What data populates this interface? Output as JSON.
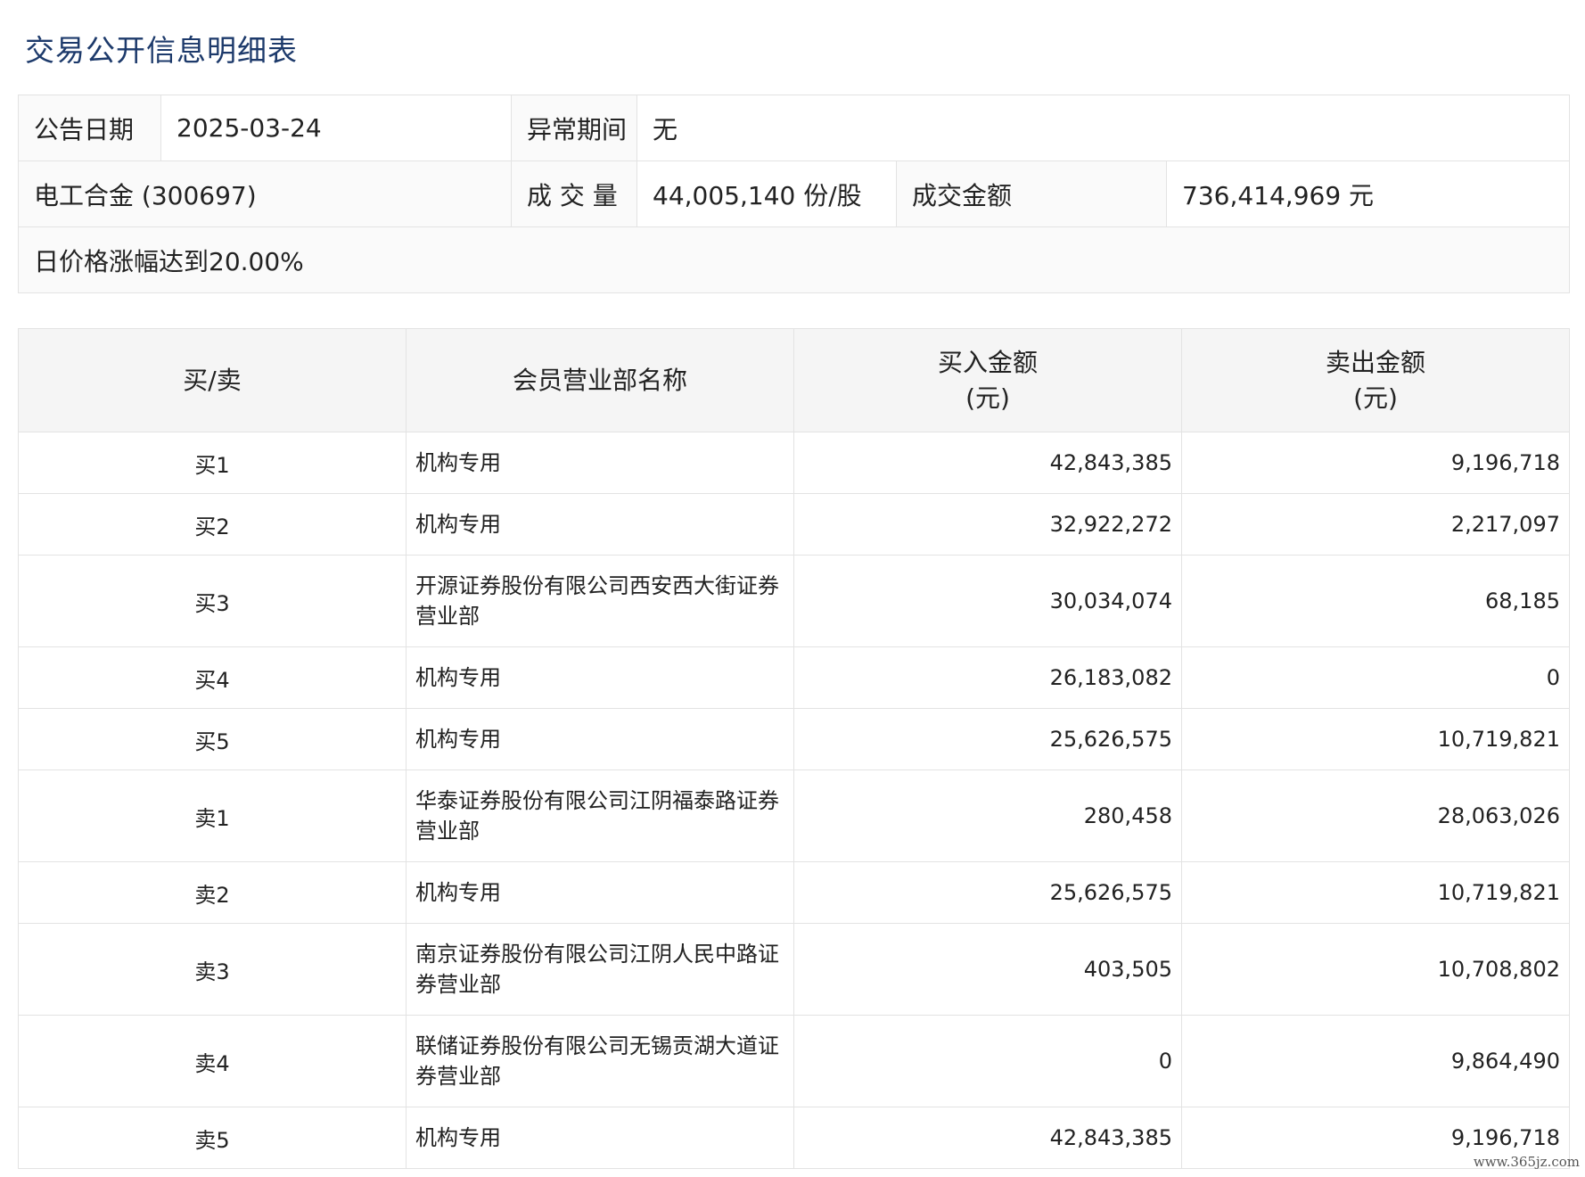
{
  "page_title": "交易公开信息明细表",
  "info": {
    "announce_date_label": "公告日期",
    "announce_date_value": "2025-03-24",
    "abnormal_period_label": "异常期间",
    "abnormal_period_value": "无",
    "stock_name": "电工合金 (300697)",
    "volume_label": "成 交 量",
    "volume_value": "44,005,140 份/股",
    "turnover_label": "成交金额",
    "turnover_value": "736,414,969 元",
    "reason": "日价格涨幅达到20.00%"
  },
  "table": {
    "headers": {
      "side": "买/卖",
      "member": "会员营业部名称",
      "buy_line1": "买入金额",
      "buy_line2": "(元)",
      "sell_line1": "卖出金额",
      "sell_line2": "(元)"
    },
    "rows": [
      {
        "side": "买1",
        "name": "机构专用",
        "buy": "42,843,385",
        "sell": "9,196,718"
      },
      {
        "side": "买2",
        "name": "机构专用",
        "buy": "32,922,272",
        "sell": "2,217,097"
      },
      {
        "side": "买3",
        "name": "开源证券股份有限公司西安西大街证券营业部",
        "buy": "30,034,074",
        "sell": "68,185"
      },
      {
        "side": "买4",
        "name": "机构专用",
        "buy": "26,183,082",
        "sell": "0"
      },
      {
        "side": "买5",
        "name": "机构专用",
        "buy": "25,626,575",
        "sell": "10,719,821"
      },
      {
        "side": "卖1",
        "name": "华泰证券股份有限公司江阴福泰路证券营业部",
        "buy": "280,458",
        "sell": "28,063,026"
      },
      {
        "side": "卖2",
        "name": "机构专用",
        "buy": "25,626,575",
        "sell": "10,719,821"
      },
      {
        "side": "卖3",
        "name": "南京证券股份有限公司江阴人民中路证券营业部",
        "buy": "403,505",
        "sell": "10,708,802"
      },
      {
        "side": "卖4",
        "name": "联储证券股份有限公司无锡贡湖大道证券营业部",
        "buy": "0",
        "sell": "9,864,490"
      },
      {
        "side": "卖5",
        "name": "机构专用",
        "buy": "42,843,385",
        "sell": "9,196,718"
      }
    ]
  },
  "watermark": "www.365jz.com"
}
